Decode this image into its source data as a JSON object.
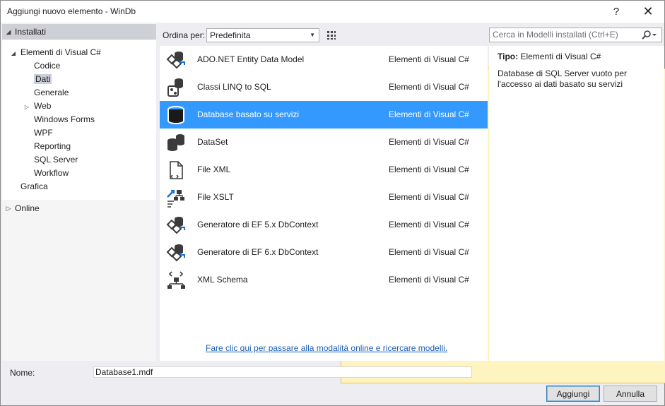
{
  "window": {
    "title": "Aggiungi nuovo elemento - WinDb",
    "help_label": "?",
    "close_label": "✕"
  },
  "tree": {
    "installed_label": "Installati",
    "items": [
      {
        "label": "Elementi di Visual C#",
        "indent": 1,
        "expander": "◢"
      },
      {
        "label": "Codice",
        "indent": 2
      },
      {
        "label": "Dati",
        "indent": 2,
        "selected": true
      },
      {
        "label": "Generale",
        "indent": 2
      },
      {
        "label": "Web",
        "indent": 2,
        "expander": "▷"
      },
      {
        "label": "Windows Forms",
        "indent": 2
      },
      {
        "label": "WPF",
        "indent": 2
      },
      {
        "label": "Reporting",
        "indent": 2
      },
      {
        "label": "SQL Server",
        "indent": 2
      },
      {
        "label": "Workflow",
        "indent": 2
      },
      {
        "label": "Grafica",
        "indent": 1
      }
    ],
    "online_label": "Online"
  },
  "toolbar": {
    "sort_label": "Ordina per:",
    "sort_value": "Predefinita",
    "search_placeholder": "Cerca in Modelli installati (Ctrl+E)"
  },
  "templates": [
    {
      "name": "ADO.NET Entity Data Model",
      "category": "Elementi di Visual C#",
      "icon": "entity-model-icon"
    },
    {
      "name": "Classi LINQ to SQL",
      "category": "Elementi di Visual C#",
      "icon": "linq-classes-icon"
    },
    {
      "name": "Database basato su servizi",
      "category": "Elementi di Visual C#",
      "icon": "database-icon",
      "selected": true
    },
    {
      "name": "DataSet",
      "category": "Elementi di Visual C#",
      "icon": "dataset-icon"
    },
    {
      "name": "File XML",
      "category": "Elementi di Visual C#",
      "icon": "xml-file-icon"
    },
    {
      "name": "File XSLT",
      "category": "Elementi di Visual C#",
      "icon": "xslt-file-icon"
    },
    {
      "name": "Generatore di EF 5.x DbContext",
      "category": "Elementi di Visual C#",
      "icon": "ef-generator-icon"
    },
    {
      "name": "Generatore di EF 6.x DbContext",
      "category": "Elementi di Visual C#",
      "icon": "ef-generator-icon"
    },
    {
      "name": "XML Schema",
      "category": "Elementi di Visual C#",
      "icon": "xml-schema-icon"
    }
  ],
  "online_link": "Fare clic qui per passare alla modalità online e ricercare modelli.",
  "detail": {
    "type_label": "Tipo:",
    "type_value": "Elementi di Visual C#",
    "description": "Database di SQL Server vuoto per l'accesso ai dati basato su servizi"
  },
  "footer": {
    "name_label": "Nome:",
    "name_value": "Database1.mdf",
    "add_label": "Aggiungi",
    "cancel_label": "Annulla"
  },
  "colors": {
    "selection": "#3399ff",
    "link": "#1a5fb4",
    "tree_selected": "#cccedb"
  }
}
